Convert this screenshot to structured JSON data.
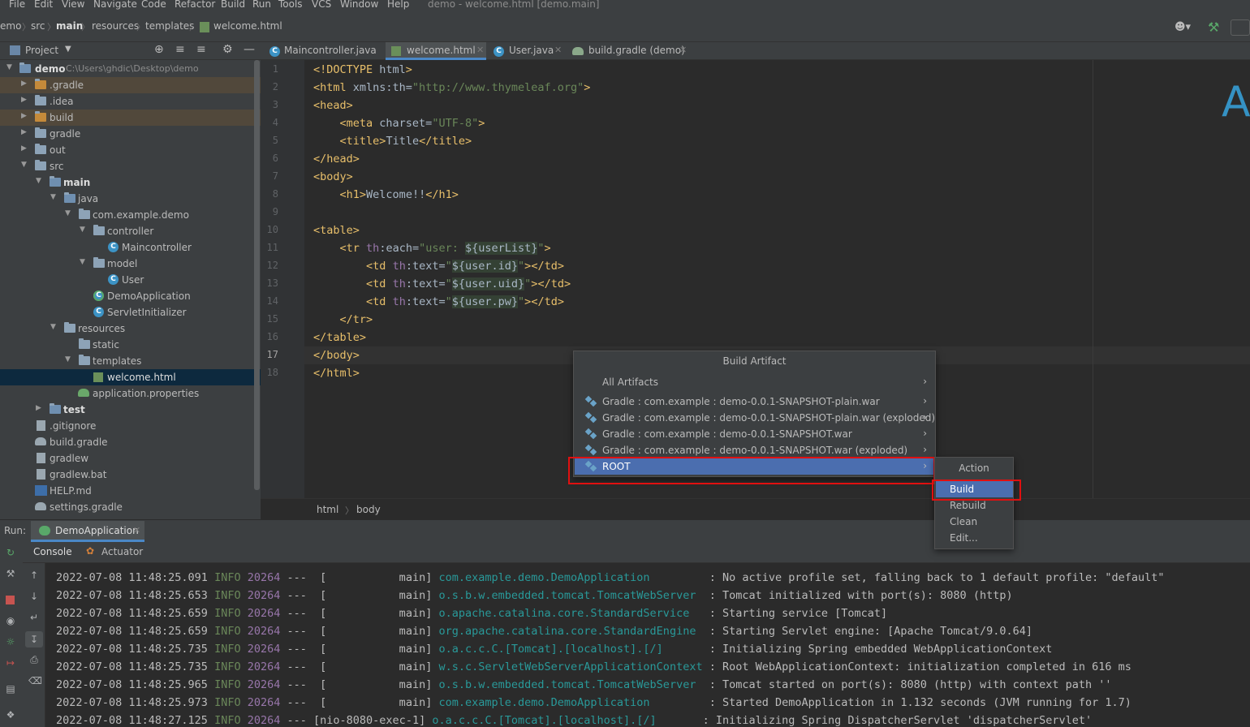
{
  "window": {
    "title": "demo - welcome.html [demo.main]"
  },
  "menu": [
    "File",
    "Edit",
    "View",
    "Navigate",
    "Code",
    "Refactor",
    "Build",
    "Run",
    "Tools",
    "VCS",
    "Window",
    "Help"
  ],
  "breadcrumb": [
    "emo",
    "src",
    "main",
    "resources",
    "templates",
    "welcome.html"
  ],
  "project_panel": {
    "title": "Project"
  },
  "tabs": [
    {
      "label": "Maincontroller.java"
    },
    {
      "label": "welcome.html"
    },
    {
      "label": "User.java"
    },
    {
      "label": "build.gradle (demo)"
    }
  ],
  "tree": {
    "root_name": "demo",
    "root_path": "C:\\Users\\ghdic\\Desktop\\demo",
    "items": [
      ".gradle",
      ".idea",
      "build",
      "gradle",
      "out",
      "src",
      "main",
      "java",
      "com.example.demo",
      "controller",
      "Maincontroller",
      "model",
      "User",
      "DemoApplication",
      "ServletInitializer",
      "resources",
      "static",
      "templates",
      "welcome.html",
      "application.properties",
      "test",
      ".gitignore",
      "build.gradle",
      "gradlew",
      "gradlew.bat",
      "HELP.md",
      "settings.gradle"
    ]
  },
  "editor": {
    "line_numbers": [
      "1",
      "2",
      "3",
      "4",
      "5",
      "6",
      "7",
      "8",
      "9",
      "10",
      "11",
      "12",
      "13",
      "14",
      "15",
      "16",
      "17",
      "18"
    ],
    "lines": [
      "<!DOCTYPE html>",
      "<html xmlns:th=\"http://www.thymeleaf.org\">",
      "<head>",
      "    <meta charset=\"UTF-8\">",
      "    <title>Title</title>",
      "</head>",
      "<body>",
      "    <h1>Welcome!!</h1>",
      "",
      "<table>",
      "    <tr th:each=\"user: ${userList}\">",
      "        <td th:text=\"${user.id}\"></td>",
      "        <td th:text=\"${user.uid}\"></td>",
      "        <td th:text=\"${user.pw}\"></td>",
      "    </tr>",
      "</table>",
      "</body>",
      "</html>"
    ],
    "big_letter": "A",
    "crumbs": [
      "html",
      "body"
    ]
  },
  "build_artifact_popup": {
    "title": "Build Artifact",
    "items": [
      "All Artifacts",
      "Gradle : com.example : demo-0.0.1-SNAPSHOT-plain.war",
      "Gradle : com.example : demo-0.0.1-SNAPSHOT-plain.war (exploded)",
      "Gradle : com.example : demo-0.0.1-SNAPSHOT.war",
      "Gradle : com.example : demo-0.0.1-SNAPSHOT.war (exploded)",
      "ROOT"
    ]
  },
  "action_popup": {
    "title": "Action",
    "items": [
      "Build",
      "Rebuild",
      "Clean",
      "Edit..."
    ]
  },
  "run_panel": {
    "label": "Run:",
    "config": "DemoApplication",
    "tabs": [
      "Console",
      "Actuator"
    ]
  },
  "console": {
    "lines": [
      {
        "ts": "2022-07-08 11:48:25.091",
        "level": "INFO",
        "pid": "20264",
        "thread": "---  [           main]",
        "logger": "com.example.demo.DemoApplication        ",
        "msg": " : No active profile set, falling back to 1 default profile: \"default\""
      },
      {
        "ts": "2022-07-08 11:48:25.653",
        "level": "INFO",
        "pid": "20264",
        "thread": "---  [           main]",
        "logger": "o.s.b.w.embedded.tomcat.TomcatWebServer ",
        "msg": " : Tomcat initialized with port(s): 8080 (http)"
      },
      {
        "ts": "2022-07-08 11:48:25.659",
        "level": "INFO",
        "pid": "20264",
        "thread": "---  [           main]",
        "logger": "o.apache.catalina.core.StandardService  ",
        "msg": " : Starting service [Tomcat]"
      },
      {
        "ts": "2022-07-08 11:48:25.659",
        "level": "INFO",
        "pid": "20264",
        "thread": "---  [           main]",
        "logger": "org.apache.catalina.core.StandardEngine ",
        "msg": " : Starting Servlet engine: [Apache Tomcat/9.0.64]"
      },
      {
        "ts": "2022-07-08 11:48:25.735",
        "level": "INFO",
        "pid": "20264",
        "thread": "---  [           main]",
        "logger": "o.a.c.c.C.[Tomcat].[localhost].[/]      ",
        "msg": " : Initializing Spring embedded WebApplicationContext"
      },
      {
        "ts": "2022-07-08 11:48:25.735",
        "level": "INFO",
        "pid": "20264",
        "thread": "---  [           main]",
        "logger": "w.s.c.ServletWebServerApplicationContext",
        "msg": " : Root WebApplicationContext: initialization completed in 616 ms"
      },
      {
        "ts": "2022-07-08 11:48:25.965",
        "level": "INFO",
        "pid": "20264",
        "thread": "---  [           main]",
        "logger": "o.s.b.w.embedded.tomcat.TomcatWebServer ",
        "msg": " : Tomcat started on port(s): 8080 (http) with context path ''"
      },
      {
        "ts": "2022-07-08 11:48:25.973",
        "level": "INFO",
        "pid": "20264",
        "thread": "---  [           main]",
        "logger": "com.example.demo.DemoApplication        ",
        "msg": " : Started DemoApplication in 1.132 seconds (JVM running for 1.7)"
      },
      {
        "ts": "2022-07-08 11:48:27.125",
        "level": "INFO",
        "pid": "20264",
        "thread": "--- [nio-8080-exec-1]",
        "logger": "o.a.c.c.C.[Tomcat].[localhost].[/]      ",
        "msg": " : Initializing Spring DispatcherServlet 'dispatcherServlet'"
      }
    ]
  },
  "colors": {
    "accent": "#4b6eaf",
    "highlight_box": "#e01010",
    "tag": "#e8bf6a",
    "string": "#6a8759"
  }
}
